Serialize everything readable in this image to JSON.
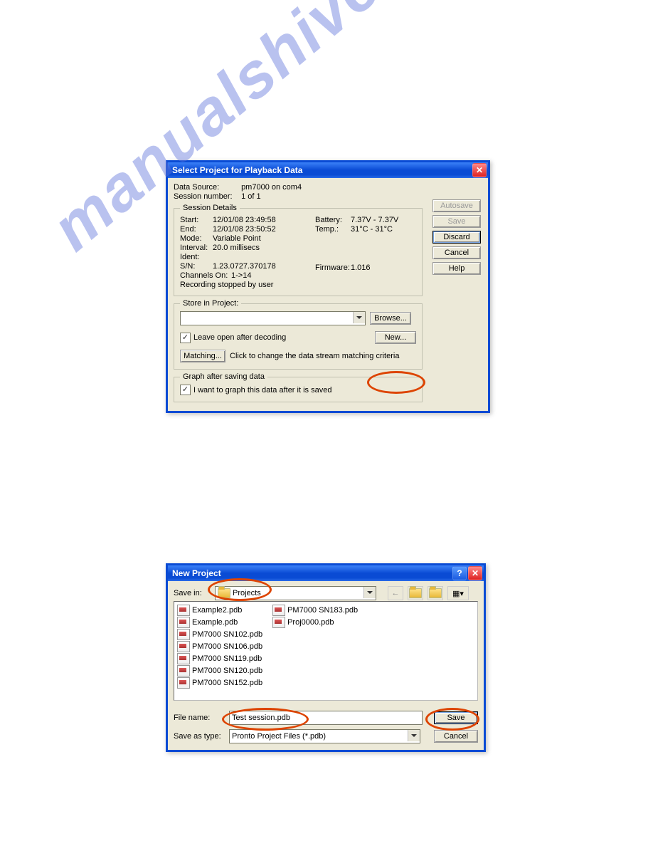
{
  "watermark": "manualshive.com",
  "dlg1": {
    "title": "Select Project for Playback Data",
    "data_source_label": "Data Source:",
    "data_source_value": "pm7000 on com4",
    "session_num_label": "Session number:",
    "session_num_value": "1 of  1",
    "session_details_legend": "Session Details",
    "start_label": "Start:",
    "start_value": "12/01/08 23:49:58",
    "end_label": "End:",
    "end_value": "12/01/08 23:50:52",
    "mode_label": "Mode:",
    "mode_value": "Variable Point",
    "interval_label": "Interval:",
    "interval_value": "20.0 millisecs",
    "ident_label": "Ident:",
    "sn_label": "S/N:",
    "sn_value": "1.23.0727.370178",
    "channels_label": "Channels On:",
    "channels_value": "1->14",
    "rec_status": "Recording stopped by user",
    "battery_label": "Battery:",
    "battery_value": "7.37V - 7.37V",
    "temp_label": "Temp.:",
    "temp_value": "31°C - 31°C",
    "firmware_label": "Firmware:",
    "firmware_value": "1.016",
    "store_legend": "Store in Project:",
    "browse_btn": "Browse...",
    "leave_open_label": "Leave open after decoding",
    "new_btn": "New...",
    "matching_btn": "Matching...",
    "matching_hint": "Click to change the data stream matching criteria",
    "graph_legend": "Graph after saving data",
    "graph_checkbox_label": "I want to graph this data after it is saved",
    "btn_autosave": "Autosave",
    "btn_save": "Save",
    "btn_discard": "Discard",
    "btn_cancel": "Cancel",
    "btn_help": "Help"
  },
  "dlg2": {
    "title": "New Project",
    "save_in_label": "Save in:",
    "save_in_value": "Projects",
    "files": [
      "Example2.pdb",
      "Example.pdb",
      "PM7000 SN102.pdb",
      "PM7000 SN106.pdb",
      "PM7000 SN119.pdb",
      "PM7000 SN120.pdb",
      "PM7000 SN152.pdb",
      "PM7000 SN183.pdb",
      "Proj0000.pdb"
    ],
    "file_name_label": "File name:",
    "file_name_value": "Test session.pdb",
    "save_as_type_label": "Save as type:",
    "save_as_type_value": "Pronto Project Files (*.pdb)",
    "save_btn": "Save",
    "cancel_btn": "Cancel"
  }
}
